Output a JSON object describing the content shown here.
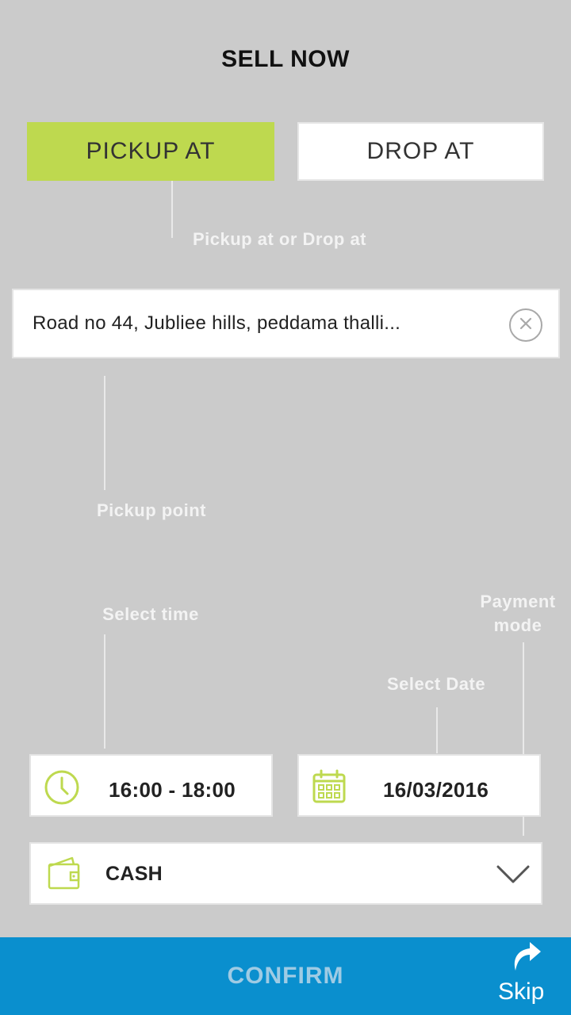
{
  "header": {
    "title": "SELL NOW"
  },
  "tabs": {
    "pickup_label": "PICKUP AT",
    "drop_label": "DROP AT"
  },
  "hints": {
    "tabs_hint": "Pickup at or Drop at",
    "pickup_point": "Pickup point",
    "select_time": "Select time",
    "payment_mode_line1": "Payment",
    "payment_mode_line2": "mode",
    "select_date": "Select Date"
  },
  "address": {
    "value": "Road no 44, Jubliee hills, peddama thalli..."
  },
  "time": {
    "value": "16:00 - 18:00"
  },
  "date": {
    "value": "16/03/2016"
  },
  "payment": {
    "value": "CASH",
    "options": [
      "CASH"
    ]
  },
  "footer": {
    "confirm_label": "CONFIRM",
    "skip_label": "Skip"
  },
  "colors": {
    "background": "#cbcbcb",
    "accent_green": "#bed94f",
    "confirm_bar": "#0a8fce",
    "confirm_text": "#9fcbe4"
  },
  "icons": [
    "close-circle-icon",
    "clock-icon",
    "calendar-icon",
    "wallet-icon",
    "chevron-down-icon",
    "skip-arrow-icon"
  ]
}
